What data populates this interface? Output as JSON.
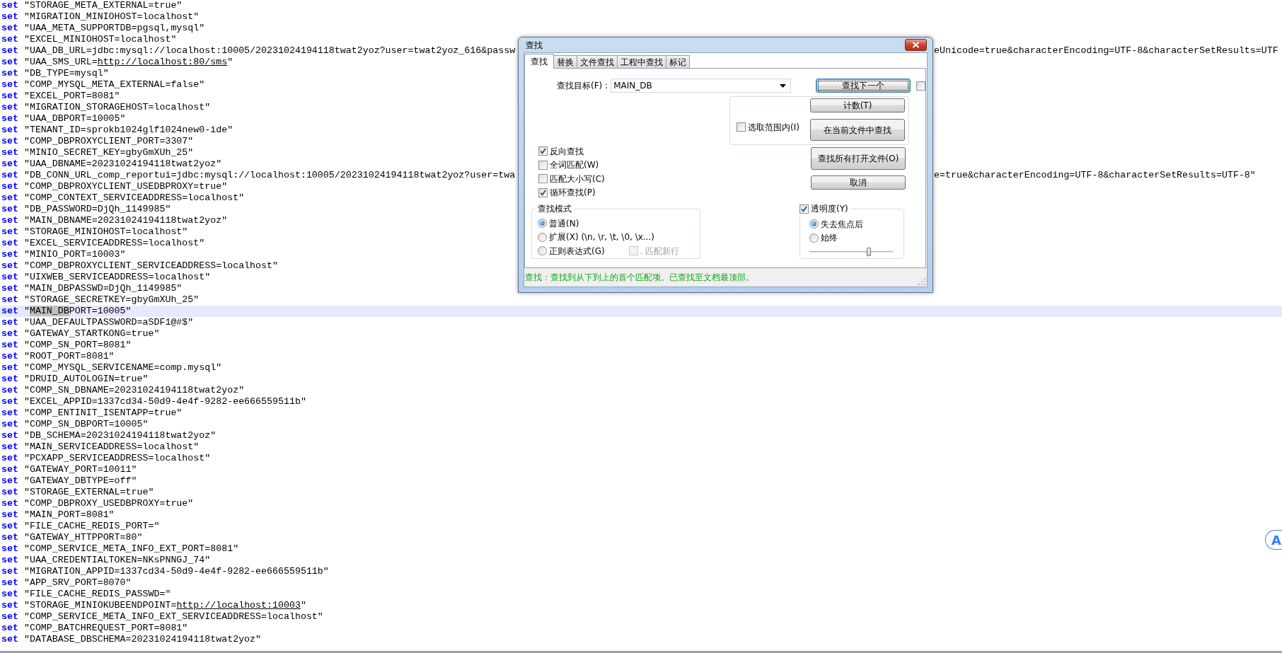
{
  "editor": {
    "lines": [
      {
        "keyword": "set",
        "text": "\"STORAGE_META_EXTERNAL=true\"",
        "current": false
      },
      {
        "keyword": "set",
        "text": "\"MIGRATION_MINIOHOST=localhost\"",
        "current": false
      },
      {
        "keyword": "set",
        "text": "\"UAA_META_SUPPORTDB=pgsql,mysql\"",
        "current": false
      },
      {
        "keyword": "set",
        "text": "\"EXCEL_MINIOHOST=localhost\"",
        "current": false
      },
      {
        "keyword": "set",
        "text": "\"UAA_DB_URL=jdbc:mysql://localhost:10005/20231024194118twat2yoz?user=twat2yoz_616&passw",
        "text_right": "eUnicode=true&characterEncoding=UTF-8&characterSetResults=UTF",
        "current": false
      },
      {
        "keyword": "set",
        "segments": [
          {
            "kind": "plain",
            "text": "\"UAA_SMS_URL="
          },
          {
            "kind": "url",
            "text": "http://localhost:80/sms"
          },
          {
            "kind": "plain",
            "text": "\""
          }
        ],
        "current": false
      },
      {
        "keyword": "set",
        "text": "\"DB_TYPE=mysql\"",
        "current": false
      },
      {
        "keyword": "set",
        "text": "\"COMP_MYSQL_META_EXTERNAL=false\"",
        "current": false
      },
      {
        "keyword": "set",
        "text": "\"EXCEL_PORT=8081\"",
        "current": false
      },
      {
        "keyword": "set",
        "text": "\"MIGRATION_STORAGEHOST=localhost\"",
        "current": false
      },
      {
        "keyword": "set",
        "text": "\"UAA_DBPORT=10005\"",
        "current": false
      },
      {
        "keyword": "set",
        "text": "\"TENANT_ID=sprokb1024glf1024new0-ide\"",
        "current": false
      },
      {
        "keyword": "set",
        "text": "\"COMP_DBPROXYCLIENT_PORT=3307\"",
        "current": false
      },
      {
        "keyword": "set",
        "text": "\"MINIO_SECRET_KEY=gbyGmXUh_25\"",
        "current": false
      },
      {
        "keyword": "set",
        "text": "\"UAA_DBNAME=20231024194118twat2yoz\"",
        "current": false
      },
      {
        "keyword": "set",
        "text": "\"DB_CONN_URL_comp_reportui=jdbc:mysql://localhost:10005/20231024194118twat2yoz?user=twa",
        "text_right": "e=true&characterEncoding=UTF-8&characterSetResults=UTF-8\"",
        "current": false
      },
      {
        "keyword": "set",
        "text": "\"COMP_DBPROXYCLIENT_USEDBPROXY=true\"",
        "current": false
      },
      {
        "keyword": "set",
        "text": "\"COMP_CONTEXT_SERVICEADDRESS=localhost\"",
        "current": false
      },
      {
        "keyword": "set",
        "text": "\"DB_PASSWORD=DjQh_1149985\"",
        "current": false
      },
      {
        "keyword": "set",
        "text": "\"MAIN_DBNAME=20231024194118twat2yoz\"",
        "current": false
      },
      {
        "keyword": "set",
        "text": "\"STORAGE_MINIOHOST=localhost\"",
        "current": false
      },
      {
        "keyword": "set",
        "text": "\"EXCEL_SERVICEADDRESS=localhost\"",
        "current": false
      },
      {
        "keyword": "set",
        "text": "\"MINIO_PORT=10003\"",
        "current": false
      },
      {
        "keyword": "set",
        "text": "\"COMP_DBPROXYCLIENT_SERVICEADDRESS=localhost\"",
        "current": false
      },
      {
        "keyword": "set",
        "text": "\"UIXWEB_SERVICEADDRESS=localhost\"",
        "current": false
      },
      {
        "keyword": "set",
        "text": "\"MAIN_DBPASSWD=DjQh_1149985\"",
        "current": false
      },
      {
        "keyword": "set",
        "text": "\"STORAGE_SECRETKEY=gbyGmXUh_25\"",
        "current": false
      },
      {
        "keyword": "set",
        "segments": [
          {
            "kind": "plain",
            "text": "\""
          },
          {
            "kind": "match",
            "text": "MAIN_DB"
          },
          {
            "kind": "plain",
            "text": "PORT=10005\""
          }
        ],
        "current": true
      },
      {
        "keyword": "set",
        "text": "\"UAA_DEFAULTPASSWORD=aSDF1@#$\"",
        "current": false
      },
      {
        "keyword": "set",
        "text": "\"GATEWAY_STARTKONG=true\"",
        "current": false
      },
      {
        "keyword": "set",
        "text": "\"COMP_SN_PORT=8081\"",
        "current": false
      },
      {
        "keyword": "set",
        "text": "\"ROOT_PORT=8081\"",
        "current": false
      },
      {
        "keyword": "set",
        "text": "\"COMP_MYSQL_SERVICENAME=comp.mysql\"",
        "current": false
      },
      {
        "keyword": "set",
        "text": "\"DRUID_AUTOLOGIN=true\"",
        "current": false
      },
      {
        "keyword": "set",
        "text": "\"COMP_SN_DBNAME=20231024194118twat2yoz\"",
        "current": false
      },
      {
        "keyword": "set",
        "text": "\"EXCEL_APPID=1337cd34-50d9-4e4f-9282-ee666559511b\"",
        "current": false
      },
      {
        "keyword": "set",
        "text": "\"COMP_ENTINIT_ISENTAPP=true\"",
        "current": false
      },
      {
        "keyword": "set",
        "text": "\"COMP_SN_DBPORT=10005\"",
        "current": false
      },
      {
        "keyword": "set",
        "text": "\"DB_SCHEMA=20231024194118twat2yoz\"",
        "current": false
      },
      {
        "keyword": "set",
        "text": "\"MAIN_SERVICEADDRESS=localhost\"",
        "current": false
      },
      {
        "keyword": "set",
        "text": "\"PCXAPP_SERVICEADDRESS=localhost\"",
        "current": false
      },
      {
        "keyword": "set",
        "text": "\"GATEWAY_PORT=10011\"",
        "current": false
      },
      {
        "keyword": "set",
        "text": "\"GATEWAY_DBTYPE=off\"",
        "current": false
      },
      {
        "keyword": "set",
        "text": "\"STORAGE_EXTERNAL=true\"",
        "current": false
      },
      {
        "keyword": "set",
        "text": "\"COMP_DBPROXY_USEDBPROXY=true\"",
        "current": false
      },
      {
        "keyword": "set",
        "text": "\"MAIN_PORT=8081\"",
        "current": false
      },
      {
        "keyword": "set",
        "text": "\"FILE_CACHE_REDIS_PORT=\"",
        "current": false
      },
      {
        "keyword": "set",
        "text": "\"GATEWAY_HTTPPORT=80\"",
        "current": false
      },
      {
        "keyword": "set",
        "text": "\"COMP_SERVICE_META_INFO_EXT_PORT=8081\"",
        "current": false
      },
      {
        "keyword": "set",
        "text": "\"UAA_CREDENTIALTOKEN=NKsPNNGJ_74\"",
        "current": false
      },
      {
        "keyword": "set",
        "text": "\"MIGRATION_APPID=1337cd34-50d9-4e4f-9282-ee666559511b\"",
        "current": false
      },
      {
        "keyword": "set",
        "text": "\"APP_SRV_PORT=8070\"",
        "current": false
      },
      {
        "keyword": "set",
        "text": "\"FILE_CACHE_REDIS_PASSWD=\"",
        "current": false
      },
      {
        "keyword": "set",
        "segments": [
          {
            "kind": "plain",
            "text": "\"STORAGE_MINIOKUBEENDPOINT="
          },
          {
            "kind": "url",
            "text": "http://localhost:10003"
          },
          {
            "kind": "plain",
            "text": "\""
          }
        ],
        "current": false
      },
      {
        "keyword": "set",
        "text": "\"COMP_SERVICE_META_INFO_EXT_SERVICEADDRESS=localhost\"",
        "current": false
      },
      {
        "keyword": "set",
        "text": "\"COMP_BATCHREQUEST_PORT=8081\"",
        "current": false
      },
      {
        "keyword": "set",
        "text": "\"DATABASE_DBSCHEMA=20231024194118twat2yoz\"",
        "current": false
      }
    ]
  },
  "find_dialog": {
    "title": "查找",
    "tabs": [
      {
        "label": "查找",
        "selected": true
      },
      {
        "label": "替换",
        "selected": false
      },
      {
        "label": "文件查找",
        "selected": false
      },
      {
        "label": "工程中查找",
        "selected": false
      },
      {
        "label": "标记",
        "selected": false
      }
    ],
    "find_what": {
      "label": "查找目标(F) :",
      "value": "MAIN_DB"
    },
    "find_next": "查找下一个",
    "side_checkbox": {
      "checked": false
    },
    "in_selection": {
      "label": "选取范围内(I)",
      "checked": false
    },
    "count": "计数(T)",
    "find_in_current": "在当前文件中查找",
    "find_all_open": "查找所有打开文件(O)",
    "cancel": "取消",
    "options": [
      {
        "label": "反向查找",
        "checked": true
      },
      {
        "label": "全词匹配(W)",
        "checked": false
      },
      {
        "label": "匹配大小写(C)",
        "checked": false
      },
      {
        "label": "循环查找(P)",
        "checked": true
      }
    ],
    "search_mode": {
      "title": "查找模式",
      "options": [
        {
          "label": "普通(N)",
          "selected": true
        },
        {
          "label": "扩展(X) (\\n, \\r, \\t, \\0, \\x...)",
          "selected": false
        },
        {
          "label": "正则表达式(G)",
          "selected": false
        }
      ],
      "dot_newline": {
        "label": ". 匹配新行",
        "checked": false,
        "disabled": true
      }
    },
    "transparency": {
      "label": "透明度(Y)",
      "checked": true,
      "options": [
        {
          "label": "失去焦点后",
          "selected": true
        },
        {
          "label": "始终",
          "selected": false
        }
      ],
      "level": 0.71
    },
    "status": "查找：查找到从下到上的首个匹配项。已查找至文档最顶部。"
  },
  "floating_button": {
    "label": "A"
  }
}
